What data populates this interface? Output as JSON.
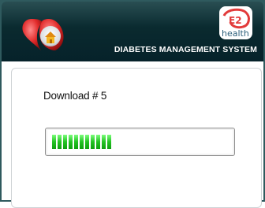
{
  "header": {
    "system_title": "DIABETES MANAGEMENT SYSTEM",
    "brand_logo_text": "health",
    "brand_logo_mark": "E2"
  },
  "download": {
    "label": "Download # 5",
    "progress_fraction": 0.27,
    "segments_filled": 11
  },
  "colors": {
    "header_bg": "#0a2a2f",
    "progress_green": "#1fbf1f",
    "heart_red": "#d51f1f"
  },
  "icons": {
    "heart_house": "heart-house-icon",
    "brand": "e2-health-logo"
  }
}
